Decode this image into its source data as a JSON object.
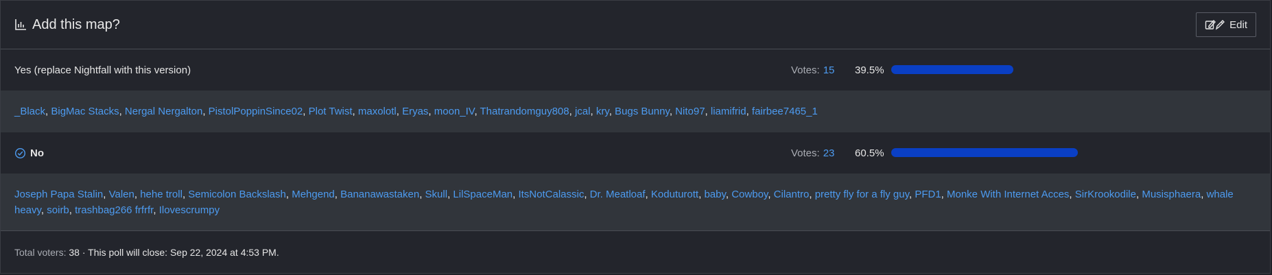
{
  "poll": {
    "title": "Add this map?",
    "edit_label": "Edit",
    "options": [
      {
        "label": "Yes (replace Nightfall with this version)",
        "votes_label": "Votes:",
        "votes": "15",
        "percent": "39.5%",
        "fraction": 0.395,
        "selected": false,
        "voters": [
          "_Black",
          "BigMac Stacks",
          "Nergal Nergalton",
          "PistolPoppinSince02",
          "Plot Twist",
          "maxolotl",
          "Eryas",
          "moon_IV",
          "Thatrandomguy808",
          "jcal",
          "kry",
          "Bugs Bunny",
          "Nito97",
          "liamifrid",
          "fairbee7465_1"
        ]
      },
      {
        "label": "No",
        "votes_label": "Votes:",
        "votes": "23",
        "percent": "60.5%",
        "fraction": 0.605,
        "selected": true,
        "voters": [
          "Joseph Papa Stalin",
          "Valen",
          "hehe troll",
          "Semicolon Backslash",
          "Mehgend",
          "Bananawastaken",
          "Skull",
          "LilSpaceMan",
          "ItsNotCalassic",
          "Dr. Meatloaf",
          "Koduturott",
          "baby",
          "Cowboy",
          "Cilantro",
          "pretty fly for a fly guy",
          "PFD1",
          "Monke With Internet Acces",
          "SirKrookodile",
          "Musisphaera",
          "whale heavy",
          "soirb",
          "trashbag266 frfrfr",
          "Ilovescrumpy"
        ]
      }
    ],
    "footer": {
      "total_label": "Total voters:",
      "total": "38",
      "close_text": "· This poll will close: Sep 22, 2024 at 4:53 PM."
    },
    "colors": {
      "accent": "#4d9bf0",
      "bar": "#0a3fc4",
      "panel": "#23252c",
      "voters_bg": "#31353b"
    },
    "icons": {
      "title": "bar-chart-icon",
      "edit": "edit-pencil-icon",
      "selected": "check-circle-icon"
    }
  }
}
